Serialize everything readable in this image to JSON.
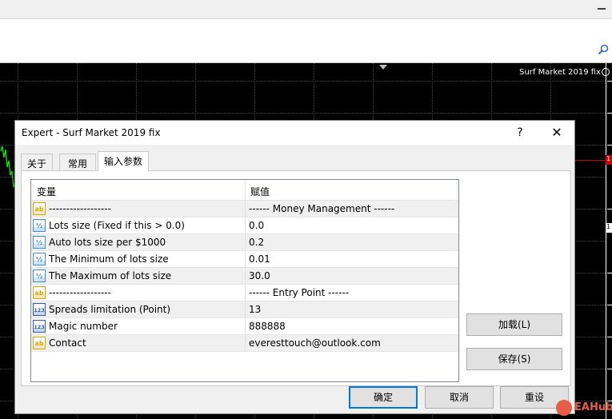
{
  "chart": {
    "title": "Surf Market 2019 fix",
    "price_labels": [
      "1",
      "1"
    ]
  },
  "dialog": {
    "title": "Expert - Surf Market 2019 fix",
    "help_glyph": "?",
    "close_glyph": "✕",
    "tabs": [
      {
        "label": "关于",
        "active": false
      },
      {
        "label": "常用",
        "active": false
      },
      {
        "label": "输入参数",
        "active": true
      }
    ],
    "table": {
      "col_variable": "变量",
      "col_value": "赋值",
      "rows": [
        {
          "type": "ab",
          "name": "------------------",
          "value": "------ Money Management ------"
        },
        {
          "type": "v2",
          "name": "Lots size (Fixed if this > 0.0)",
          "value": "0.0"
        },
        {
          "type": "v2",
          "name": "Auto lots size per $1000",
          "value": "0.2"
        },
        {
          "type": "v2",
          "name": "The Minimum of lots size",
          "value": "0.01"
        },
        {
          "type": "v2",
          "name": "The Maximum of lots size",
          "value": "30.0"
        },
        {
          "type": "ab",
          "name": "------------------",
          "value": "------ Entry Point ------"
        },
        {
          "type": "123",
          "name": "Spreads limitation (Point)",
          "value": "13"
        },
        {
          "type": "123",
          "name": "Magic number",
          "value": "888888"
        },
        {
          "type": "ab",
          "name": "Contact",
          "value": "everesttouch@outlook.com"
        }
      ]
    },
    "buttons": {
      "load": "加载(L)",
      "save": "保存(S)",
      "ok": "确定",
      "cancel": "取消",
      "reset": "重设"
    }
  },
  "watermark": {
    "text": "EAHub"
  },
  "colors": {
    "accent": "#0078d7",
    "price_line": "#cc0000",
    "candle_green": "#00ff00",
    "watermark": "#e85c4a"
  }
}
